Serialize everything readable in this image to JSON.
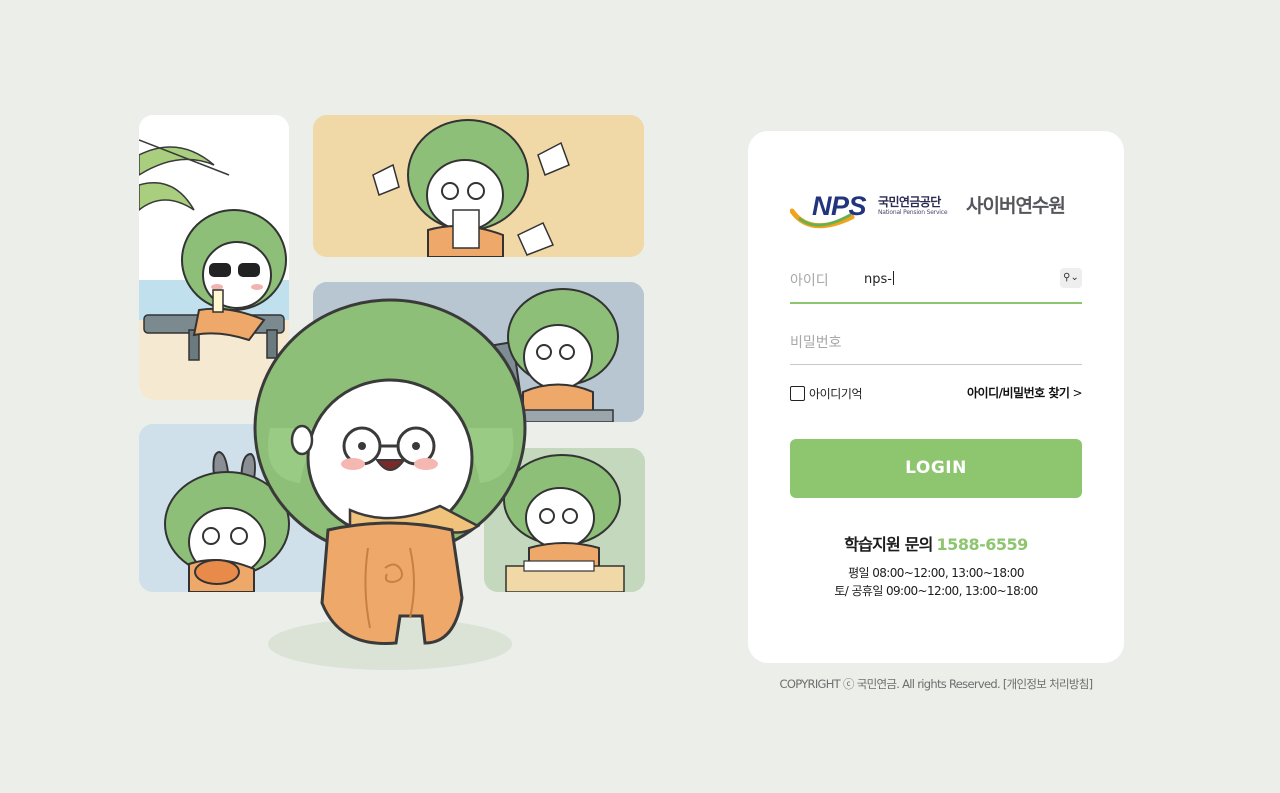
{
  "logo": {
    "brand": "NPS",
    "org_korean": "국민연금공단",
    "org_english": "National Pension Service",
    "service_name": "사이버연수원"
  },
  "login_form": {
    "id_label": "아이디",
    "id_value": "nps-",
    "password_label": "비밀번호",
    "keyboard_icon": "key-icon",
    "remember_label": "아이디기억",
    "remember_checked": false,
    "find_link": "아이디/비밀번호 찾기",
    "find_chevron": ">",
    "login_button": "LOGIN"
  },
  "support": {
    "label": "학습지원 문의",
    "phone": "1588-6559",
    "weekday_hours": "평일 08:00~12:00, 13:00~18:00",
    "weekend_hours": "토/ 공휴일 09:00~12:00, 13:00~18:00"
  },
  "footer": {
    "copyright": "COPYRIGHT ⓒ 국민연금. All rights Reserved. [개인정보 처리방침]"
  },
  "colors": {
    "accent_green": "#8ec56f",
    "page_background": "#ebeee9",
    "brand_navy": "#22347c"
  }
}
